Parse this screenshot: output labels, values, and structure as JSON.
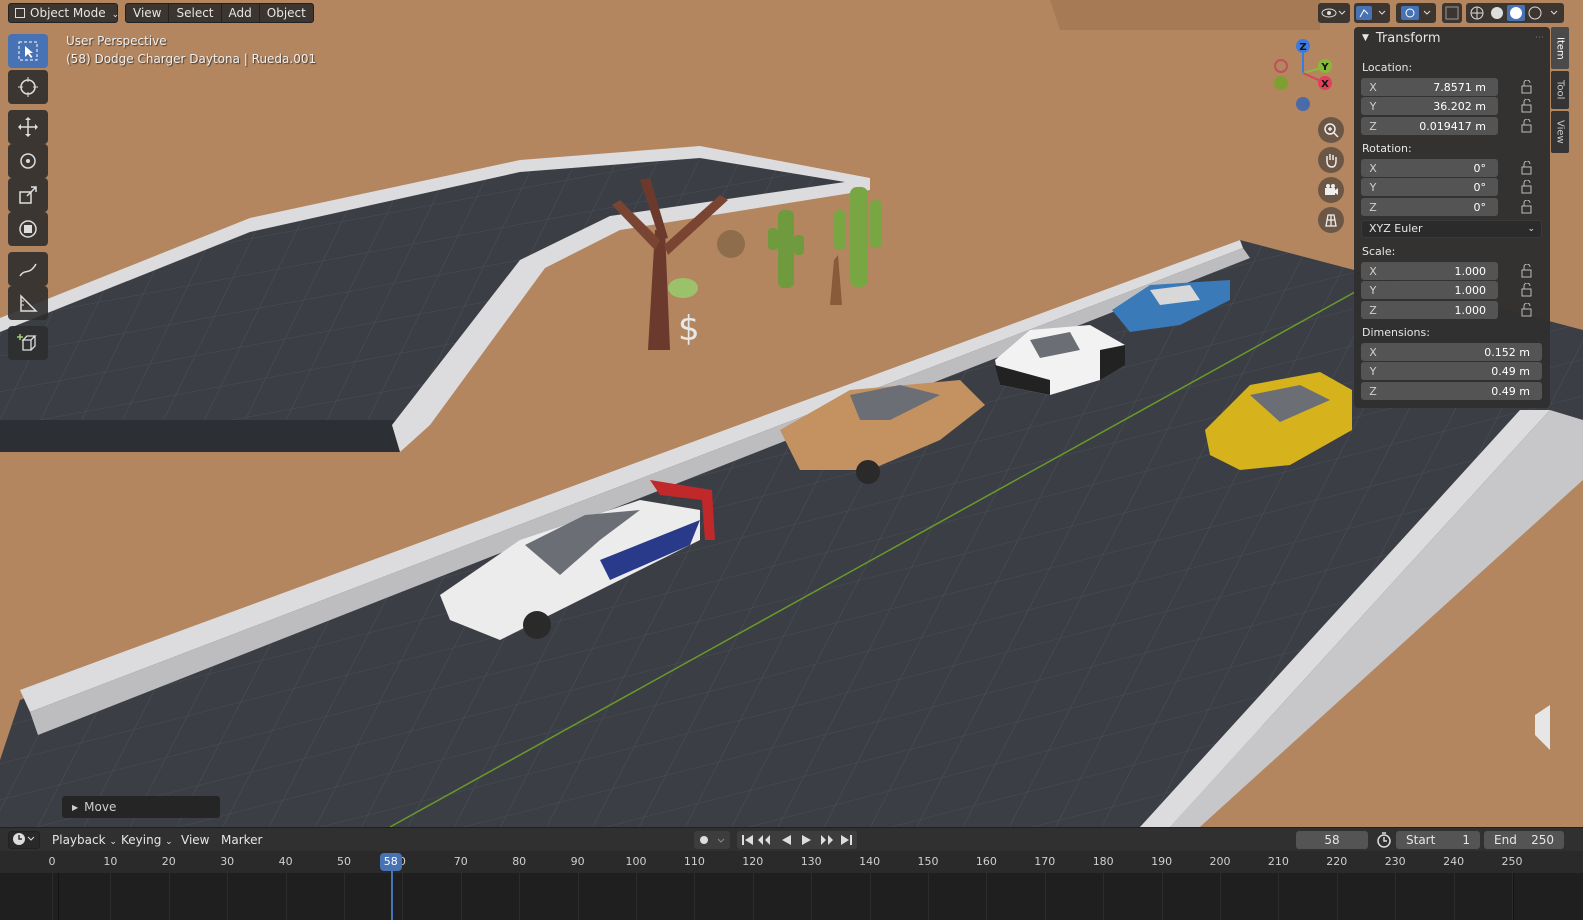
{
  "header": {
    "mode": "Object Mode",
    "menus": [
      "View",
      "Select",
      "Add",
      "Object"
    ]
  },
  "viewport": {
    "perspective": "User Perspective",
    "object_info": "(58) Dodge Charger Daytona | Rueda.001",
    "gizmo_axes": [
      "Z",
      "Y",
      "X"
    ]
  },
  "npanel": {
    "title": "Transform",
    "tabs": [
      "Item",
      "Tool",
      "View"
    ],
    "location_label": "Location:",
    "location": [
      {
        "axis": "X",
        "value": "7.8571 m"
      },
      {
        "axis": "Y",
        "value": "36.202 m"
      },
      {
        "axis": "Z",
        "value": "0.019417 m"
      }
    ],
    "rotation_label": "Rotation:",
    "rotation": [
      {
        "axis": "X",
        "value": "0°"
      },
      {
        "axis": "Y",
        "value": "0°"
      },
      {
        "axis": "Z",
        "value": "0°"
      }
    ],
    "rotation_mode": "XYZ Euler",
    "scale_label": "Scale:",
    "scale": [
      {
        "axis": "X",
        "value": "1.000"
      },
      {
        "axis": "Y",
        "value": "1.000"
      },
      {
        "axis": "Z",
        "value": "1.000"
      }
    ],
    "dimensions_label": "Dimensions:",
    "dimensions": [
      {
        "axis": "X",
        "value": "0.152 m"
      },
      {
        "axis": "Y",
        "value": "0.49 m"
      },
      {
        "axis": "Z",
        "value": "0.49 m"
      }
    ]
  },
  "operator": {
    "label": "Move"
  },
  "timeline": {
    "menus": [
      "Playback",
      "Keying",
      "View",
      "Marker"
    ],
    "current_frame": "58",
    "start_label": "Start",
    "start": "1",
    "end_label": "End",
    "end": "250",
    "ticks": [
      "0",
      "10",
      "20",
      "30",
      "40",
      "50",
      "0",
      "70",
      "80",
      "90",
      "100",
      "110",
      "120",
      "130",
      "140",
      "150",
      "160",
      "170",
      "180",
      "190",
      "200",
      "210",
      "220",
      "230",
      "240",
      "250"
    ],
    "playhead_label": "58"
  },
  "colors": {
    "accent": "#4772b3",
    "ground": "#b38660",
    "road": "#3a3e44",
    "curb": "#d9d9db"
  }
}
